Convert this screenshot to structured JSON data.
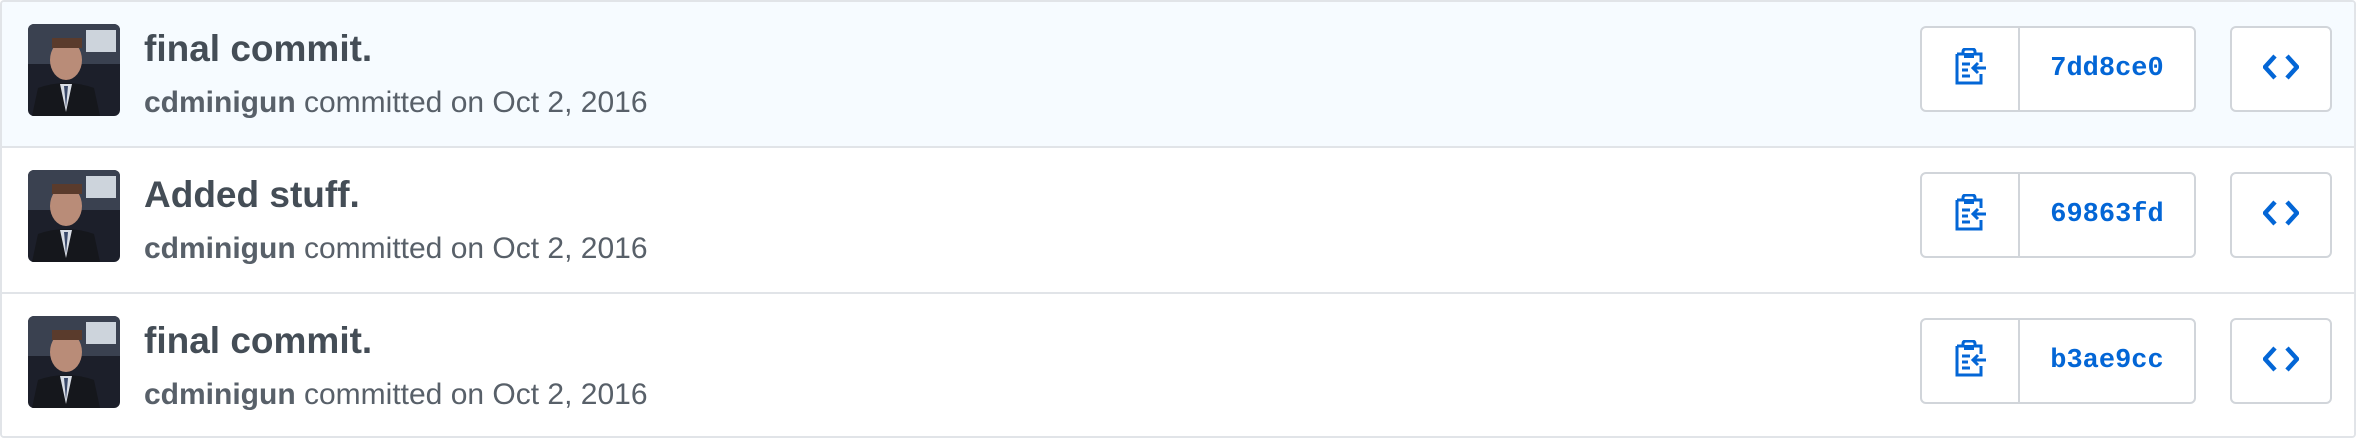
{
  "commits": [
    {
      "title": "final commit.",
      "author": "cdminigun",
      "action": "committed on Oct 2, 2016",
      "sha": "7dd8ce0",
      "copy_icon": "clippy-icon",
      "browse_icon": "code-icon"
    },
    {
      "title": "Added stuff.",
      "author": "cdminigun",
      "action": "committed on Oct 2, 2016",
      "sha": "69863fd",
      "copy_icon": "clippy-icon",
      "browse_icon": "code-icon"
    },
    {
      "title": "final commit.",
      "author": "cdminigun",
      "action": "committed on Oct 2, 2016",
      "sha": "b3ae9cc",
      "copy_icon": "clippy-icon",
      "browse_icon": "code-icon"
    }
  ],
  "colors": {
    "link_blue": "#0366d6",
    "title_gray": "#444d56",
    "meta_gray": "#586069",
    "border": "#e1e4e8",
    "highlight_row": "#f6fbff"
  }
}
